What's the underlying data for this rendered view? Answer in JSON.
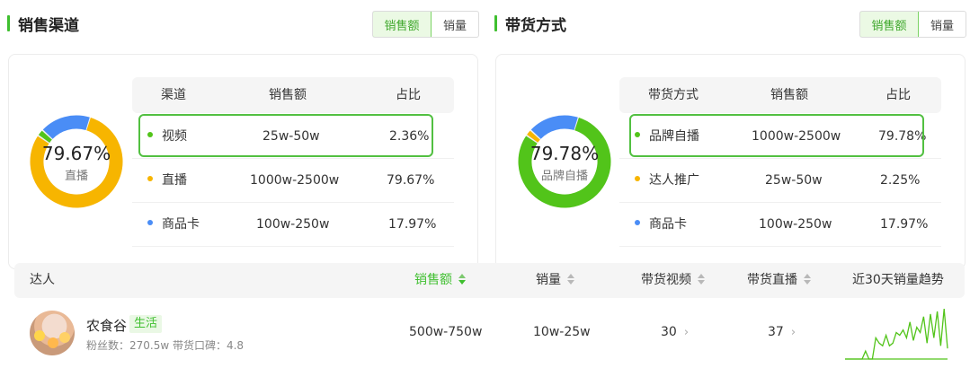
{
  "left": {
    "title": "销售渠道",
    "toggle": [
      "销售额",
      "销量"
    ],
    "donut": {
      "percent": "79.67%",
      "label": "直播"
    },
    "donut_segments": [
      {
        "name": "直播",
        "value": 79.67,
        "color": "#f7b500"
      },
      {
        "name": "视频",
        "value": 2.36,
        "color": "#52c41a"
      },
      {
        "name": "商品卡",
        "value": 17.97,
        "color": "#4a8df6"
      }
    ],
    "headers": [
      "渠道",
      "销售额",
      "占比"
    ],
    "rows": [
      {
        "name": "视频",
        "sales": "25w-50w",
        "share": "2.36%",
        "color": "#52c41a"
      },
      {
        "name": "直播",
        "sales": "1000w-2500w",
        "share": "79.67%",
        "color": "#f7b500"
      },
      {
        "name": "商品卡",
        "sales": "100w-250w",
        "share": "17.97%",
        "color": "#4a8df6"
      }
    ]
  },
  "right": {
    "title": "带货方式",
    "toggle": [
      "销售额",
      "销量"
    ],
    "donut": {
      "percent": "79.78%",
      "label": "品牌自播"
    },
    "donut_segments": [
      {
        "name": "品牌自播",
        "value": 79.78,
        "color": "#52c41a"
      },
      {
        "name": "达人推广",
        "value": 2.25,
        "color": "#f7b500"
      },
      {
        "name": "商品卡",
        "value": 17.97,
        "color": "#4a8df6"
      }
    ],
    "headers": [
      "带货方式",
      "销售额",
      "占比"
    ],
    "rows": [
      {
        "name": "品牌自播",
        "sales": "1000w-2500w",
        "share": "79.78%",
        "color": "#52c41a"
      },
      {
        "name": "达人推广",
        "sales": "25w-50w",
        "share": "2.25%",
        "color": "#f7b500"
      },
      {
        "name": "商品卡",
        "sales": "100w-250w",
        "share": "17.97%",
        "color": "#4a8df6"
      }
    ]
  },
  "influencer_table": {
    "headers": {
      "influencer": "达人",
      "sales": "销售额",
      "volume": "销量",
      "videos": "带货视频",
      "lives": "带货直播",
      "trend": "近30天销量趋势"
    },
    "row": {
      "name": "农食谷",
      "tag": "生活",
      "meta": "粉丝数：270.5w  带货口碑：4.8",
      "sales": "500w-750w",
      "volume": "10w-25w",
      "videos": "30",
      "lives": "37",
      "trend": [
        0,
        0,
        0,
        0,
        0,
        0,
        3,
        0,
        0,
        8,
        6,
        5,
        9,
        5,
        6,
        10,
        9,
        11,
        8,
        14,
        7,
        12,
        10,
        16,
        6,
        17,
        8,
        18,
        5,
        19,
        4
      ]
    }
  },
  "colors": {
    "accent": "#3fbf2f",
    "highlight": "#52c041"
  }
}
